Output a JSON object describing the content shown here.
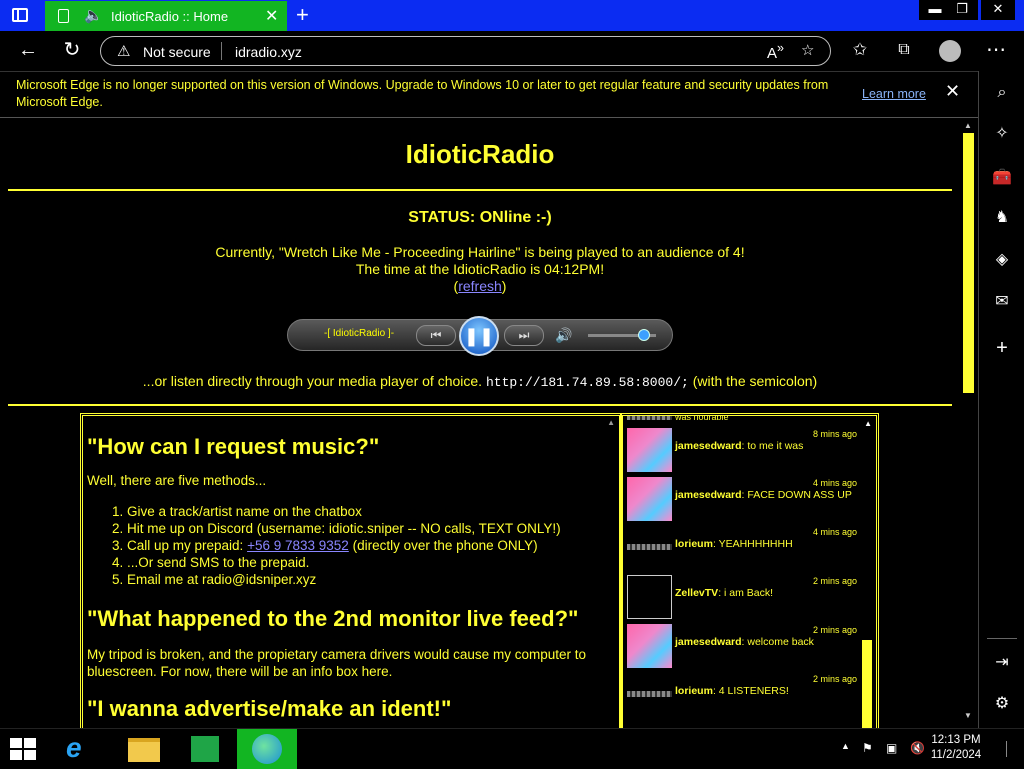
{
  "browser": {
    "tab_title": "IdioticRadio :: Home",
    "security_label": "Not secure",
    "url": "idradio.xyz"
  },
  "infobar": {
    "message": "Microsoft Edge is no longer supported on this version of Windows. Upgrade to Windows 10 or later to get regular feature and security updates from Microsoft Edge.",
    "learn_more": "Learn more"
  },
  "site": {
    "title": "IdioticRadio",
    "status": "STATUS: ONline :-)",
    "currently": "Currently, \"Wretch Like Me - Proceeding Hairline\" is being played to an audience of 4!",
    "time": "The time at the IdioticRadio is 04:12PM!",
    "refresh": "refresh",
    "player_label": "-[ IdioticRadio ]-",
    "player_volume": 0.9,
    "listen_prefix": "...or listen directly through your media player of choice.",
    "stream_url": "http://181.74.89.58:8000/;",
    "listen_suffix": "(with the semicolon)"
  },
  "faq": {
    "q1": "\"How can I request music?\"",
    "q1_intro": "Well, there are five methods...",
    "methods": [
      "Give a track/artist name on the chatbox",
      "Hit me up on Discord (username: idiotic.sniper -- NO calls, TEXT ONLY!)",
      "Call up my prepaid:",
      "...Or send SMS to the prepaid.",
      "Email me at radio@idsniper.xyz"
    ],
    "phone": "+56 9 7833 9352",
    "phone_suffix": "(directly over the phone ONLY)",
    "q2": "\"What happened to the 2nd monitor live feed?\"",
    "q2_answer": "My tripod is broken, and the propietary camera drivers would cause my computer to bluescreen. For now, there will be an info box here.",
    "q3": "\"I wanna advertise/make an ident!\""
  },
  "chat": {
    "partial_top": "was nourable",
    "messages": [
      {
        "time": "8 mins ago",
        "user": "jamesedward",
        "text": ": to me it was",
        "avatar": "pink"
      },
      {
        "time": "4 mins ago",
        "user": "jamesedward",
        "text": ": FACE DOWN ASS UP",
        "avatar": "pink"
      },
      {
        "time": "4 mins ago",
        "user": "lorieum",
        "text": ": YEAHHHHHHH",
        "avatar": "gray"
      },
      {
        "time": "2 mins ago",
        "user": "ZellevTV",
        "text": ": i am Back!",
        "avatar": "box"
      },
      {
        "time": "2 mins ago",
        "user": "jamesedward",
        "text": ": welcome back",
        "avatar": "pink"
      },
      {
        "time": "2 mins ago",
        "user": "lorieum",
        "text": ": 4 LISTENERS!",
        "avatar": "gray"
      }
    ]
  },
  "taskbar": {
    "time": "12:13 PM",
    "date": "11/2/2024"
  },
  "colors": {
    "accent": "#ffff33",
    "titlebar": "#0b2cf2",
    "tab": "#12b522",
    "link": "#8a86ff"
  }
}
